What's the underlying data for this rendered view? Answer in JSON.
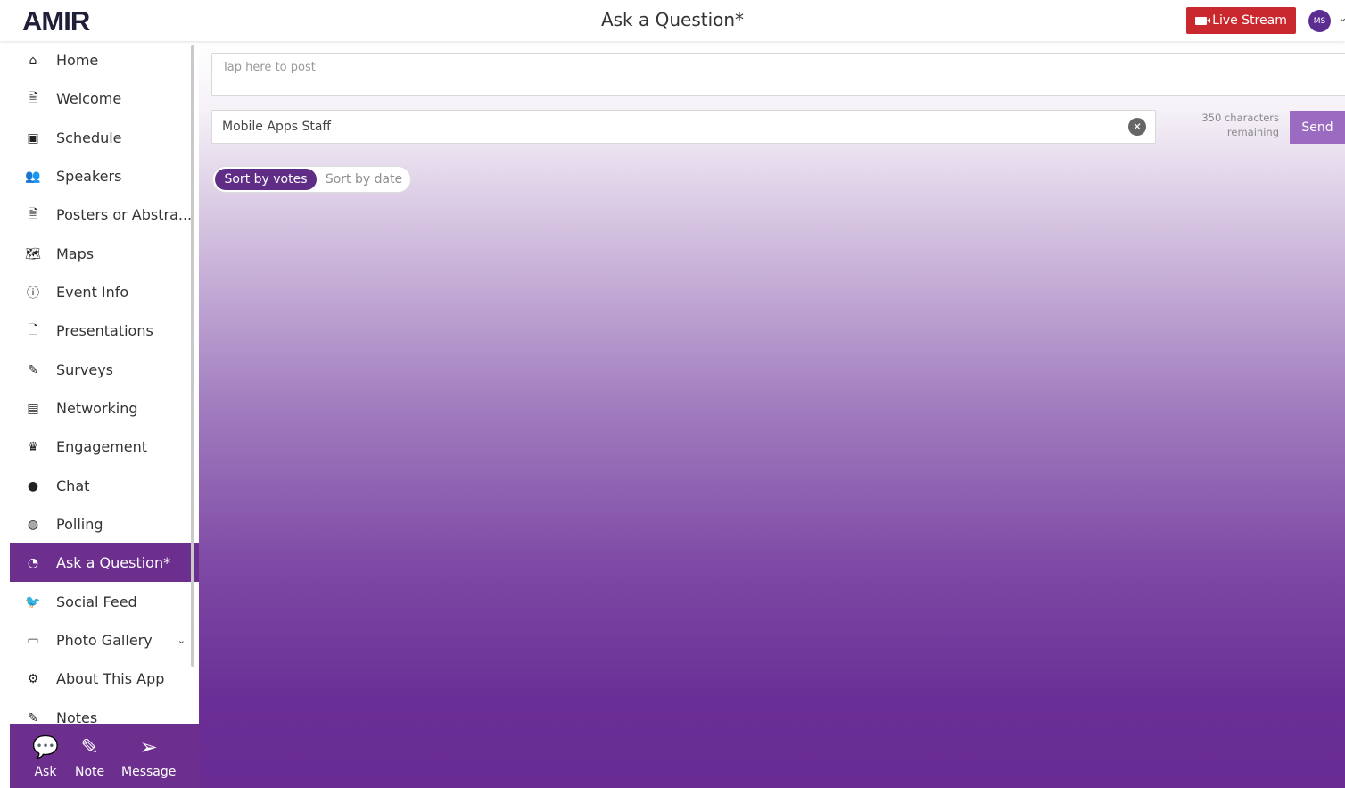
{
  "header": {
    "logo_text": "AMIR",
    "title": "Ask a Question*",
    "live_stream_label": "Live Stream",
    "live_stream_icon": "video-camera-icon",
    "avatar_initials": "MS",
    "brand_color": "#6c2f8e",
    "live_color": "#c8282e"
  },
  "sidebar": {
    "items": [
      {
        "label": "Home",
        "icon": "home-icon",
        "glyph": "⌂"
      },
      {
        "label": "Welcome",
        "icon": "document-icon",
        "glyph": "🗎"
      },
      {
        "label": "Schedule",
        "icon": "calendar-icon",
        "glyph": "▣"
      },
      {
        "label": "Speakers",
        "icon": "users-icon",
        "glyph": "👥"
      },
      {
        "label": "Posters or Abstra...",
        "icon": "document-icon",
        "glyph": "🗎"
      },
      {
        "label": "Maps",
        "icon": "map-icon",
        "glyph": "🗺"
      },
      {
        "label": "Event Info",
        "icon": "info-icon",
        "glyph": "ⓘ"
      },
      {
        "label": "Presentations",
        "icon": "pdf-file-icon",
        "glyph": "🗋"
      },
      {
        "label": "Surveys",
        "icon": "survey-icon",
        "glyph": "✎"
      },
      {
        "label": "Networking",
        "icon": "id-card-icon",
        "glyph": "▤"
      },
      {
        "label": "Engagement",
        "icon": "crown-icon",
        "glyph": "♛"
      },
      {
        "label": "Chat",
        "icon": "chat-bubble-icon",
        "glyph": "●"
      },
      {
        "label": "Polling",
        "icon": "poll-bubble-icon",
        "glyph": "◍"
      },
      {
        "label": "Ask a Question*",
        "icon": "question-bubble-icon",
        "glyph": "◔",
        "active": true
      },
      {
        "label": "Social Feed",
        "icon": "twitter-icon",
        "glyph": "🐦"
      },
      {
        "label": "Photo Gallery",
        "icon": "photo-gallery-icon",
        "glyph": "▭",
        "has_caret": true
      },
      {
        "label": "About This App",
        "icon": "gear-icon",
        "glyph": "⚙"
      },
      {
        "label": "Notes",
        "icon": "pencil-icon",
        "glyph": "✎"
      }
    ],
    "bottom_bar": [
      {
        "label": "Ask",
        "icon": "ask-icon",
        "glyph": "💬"
      },
      {
        "label": "Note",
        "icon": "pencil-icon",
        "glyph": "✎"
      },
      {
        "label": "Message",
        "icon": "paper-plane-icon",
        "glyph": "➢"
      }
    ]
  },
  "main": {
    "post_placeholder": "Tap here to post",
    "author_value": "Mobile Apps Staff",
    "char_count_line1": "350 characters",
    "char_count_line2": "remaining",
    "send_label": "Send",
    "sort_by_votes": "Sort by votes",
    "sort_by_date": "Sort by date",
    "active_sort": "votes"
  }
}
